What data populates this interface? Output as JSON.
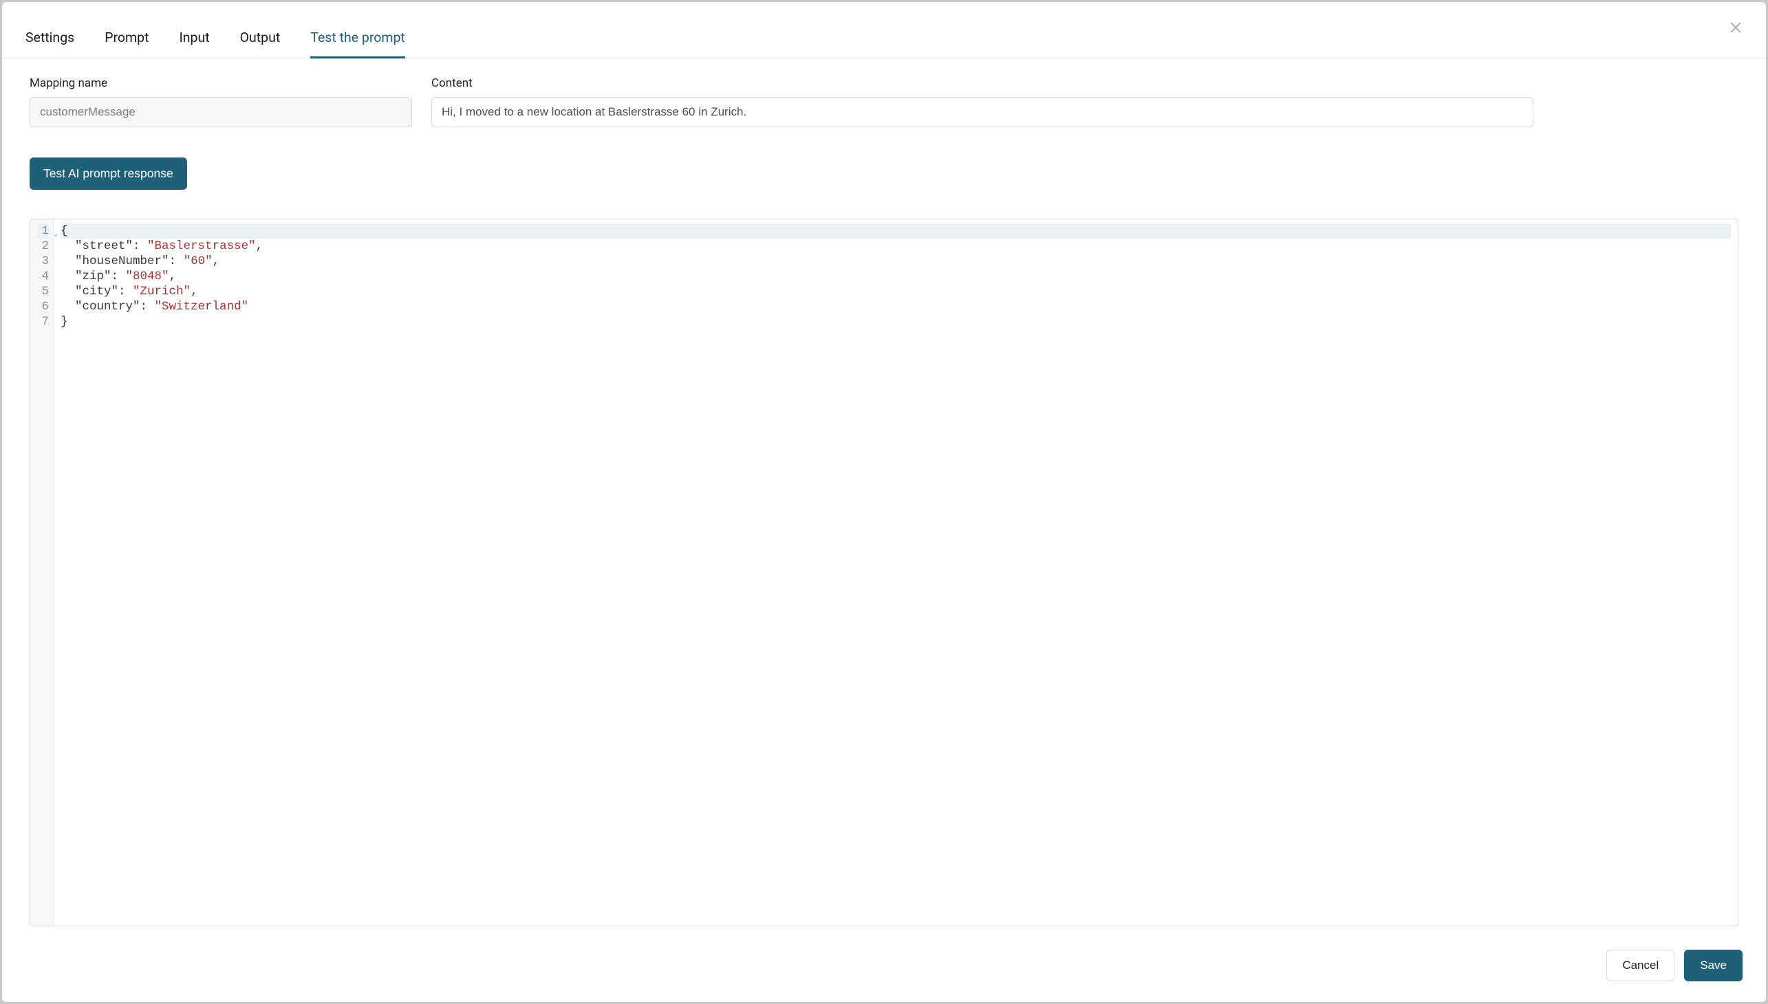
{
  "tabs": {
    "settings": "Settings",
    "prompt": "Prompt",
    "input": "Input",
    "output": "Output",
    "test": "Test the prompt"
  },
  "activeTab": "test",
  "form": {
    "mappingLabel": "Mapping name",
    "mappingValue": "customerMessage",
    "contentLabel": "Content",
    "contentValue": "Hi, I moved to a new location at Baslerstrasse 60 in Zurich."
  },
  "actions": {
    "testButton": "Test AI prompt response",
    "cancel": "Cancel",
    "save": "Save"
  },
  "code": {
    "lineNumbers": [
      "1",
      "2",
      "3",
      "4",
      "5",
      "6",
      "7"
    ],
    "lines": [
      [
        {
          "t": "punc",
          "v": "{"
        }
      ],
      [
        {
          "t": "indent",
          "v": "  "
        },
        {
          "t": "key",
          "v": "\"street\""
        },
        {
          "t": "punc",
          "v": ": "
        },
        {
          "t": "str",
          "v": "\"Baslerstrasse\""
        },
        {
          "t": "punc",
          "v": ","
        }
      ],
      [
        {
          "t": "indent",
          "v": "  "
        },
        {
          "t": "key",
          "v": "\"houseNumber\""
        },
        {
          "t": "punc",
          "v": ": "
        },
        {
          "t": "str",
          "v": "\"60\""
        },
        {
          "t": "punc",
          "v": ","
        }
      ],
      [
        {
          "t": "indent",
          "v": "  "
        },
        {
          "t": "key",
          "v": "\"zip\""
        },
        {
          "t": "punc",
          "v": ": "
        },
        {
          "t": "str",
          "v": "\"8048\""
        },
        {
          "t": "punc",
          "v": ","
        }
      ],
      [
        {
          "t": "indent",
          "v": "  "
        },
        {
          "t": "key",
          "v": "\"city\""
        },
        {
          "t": "punc",
          "v": ": "
        },
        {
          "t": "str",
          "v": "\"Zurich\""
        },
        {
          "t": "punc",
          "v": ","
        }
      ],
      [
        {
          "t": "indent",
          "v": "  "
        },
        {
          "t": "key",
          "v": "\"country\""
        },
        {
          "t": "punc",
          "v": ": "
        },
        {
          "t": "str",
          "v": "\"Switzerland\""
        }
      ],
      [
        {
          "t": "punc",
          "v": "}"
        }
      ]
    ]
  }
}
